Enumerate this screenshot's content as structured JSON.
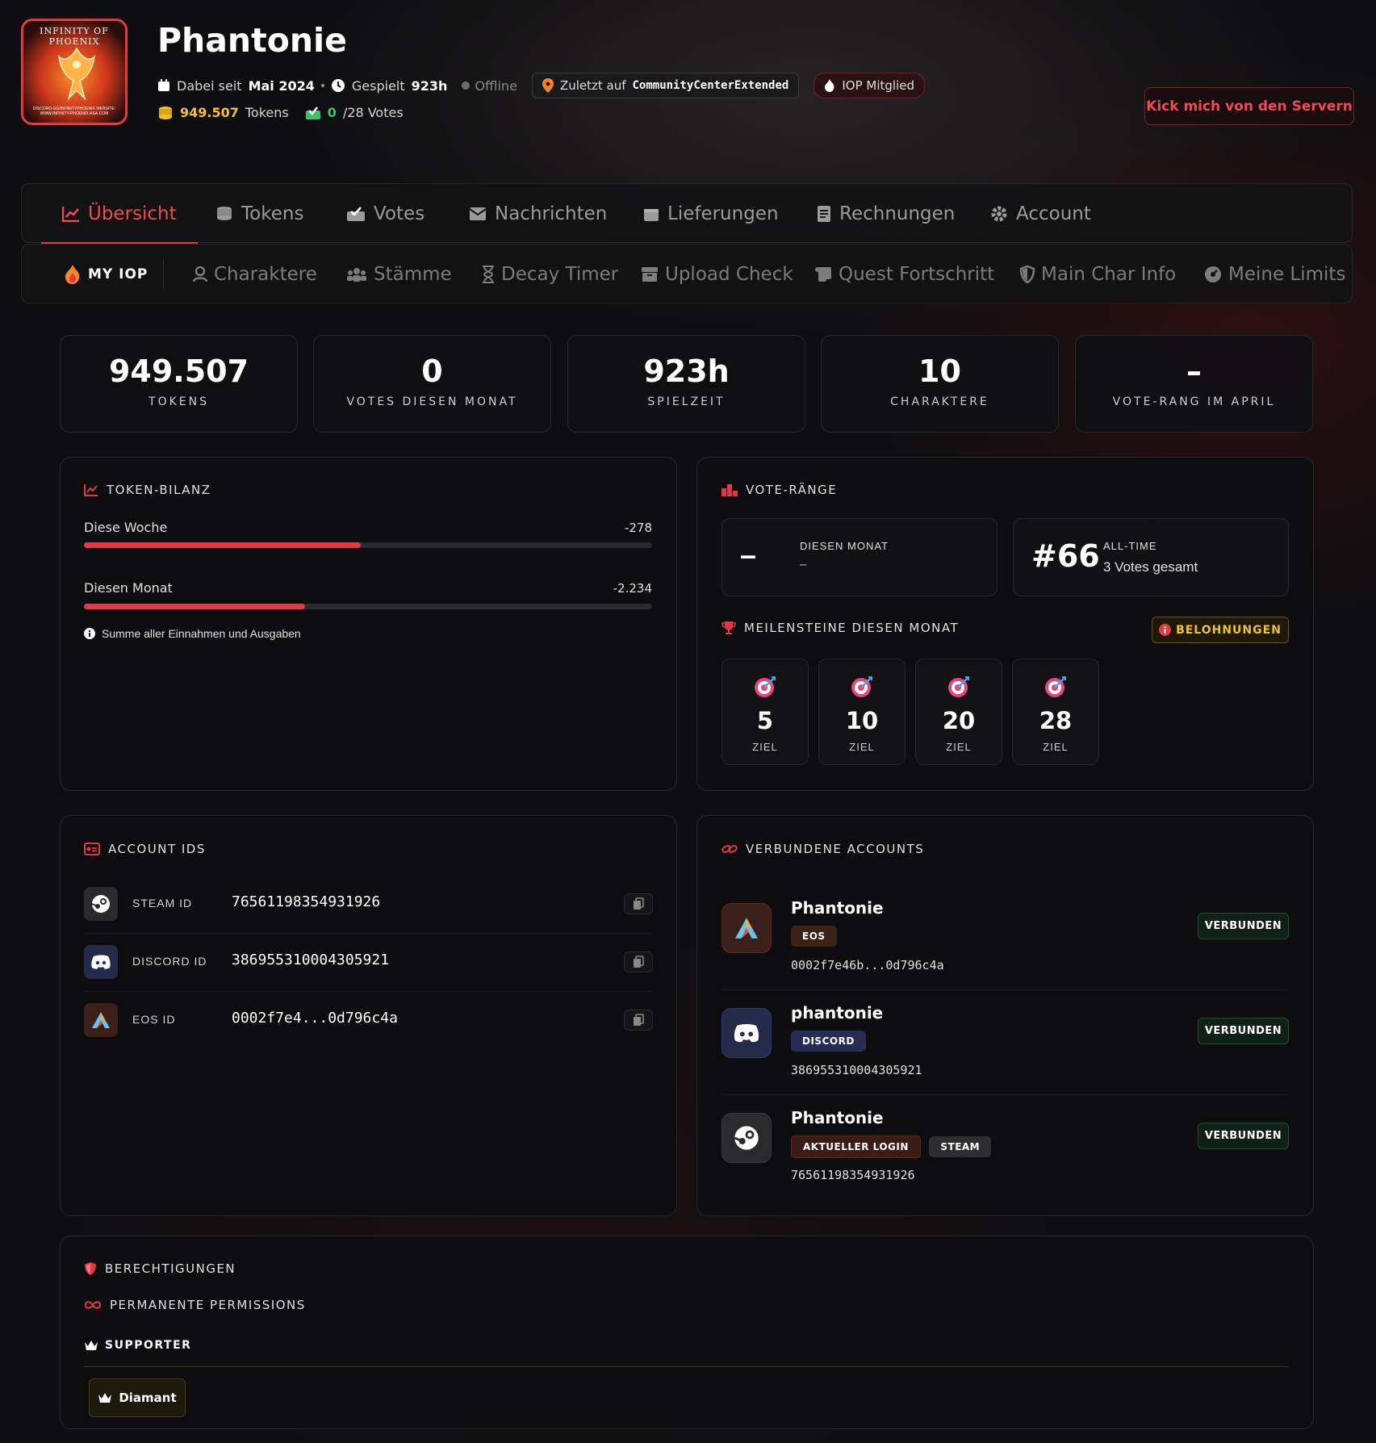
{
  "profile": {
    "logo_text_top": "INFINITY OF PHOENIX",
    "logo_text_bottom": "DISCORD.GG/INFINITYPHOENIX WEBSITE: WWW.INFINITY-PHOENIX-ASA.COM",
    "name": "Phantonie",
    "since_label": "Dabei seit",
    "since_value": "Mai 2024",
    "played_label": "Gespielt",
    "played_value": "923h",
    "status": "Offline",
    "last_on_label": "Zuletzt auf",
    "last_on_value": "CommunityCenterExtended",
    "member_badge": "IOP Mitglied",
    "tokens_value": "949.507",
    "tokens_label": "Tokens",
    "votes_value": "0",
    "votes_label": "/28 Votes",
    "kick_button": "Kick mich von den Servern"
  },
  "tabs": [
    {
      "label": "Übersicht",
      "icon": "chart-line-icon"
    },
    {
      "label": "Tokens",
      "icon": "coins-icon"
    },
    {
      "label": "Votes",
      "icon": "vote-box-icon"
    },
    {
      "label": "Nachrichten",
      "icon": "envelope-icon"
    },
    {
      "label": "Lieferungen",
      "icon": "gift-icon"
    },
    {
      "label": "Rechnungen",
      "icon": "invoice-icon"
    },
    {
      "label": "Account",
      "icon": "gear-icon"
    }
  ],
  "subtabs": [
    {
      "label": "MY IOP",
      "icon": "flame-icon"
    },
    {
      "label": "Charaktere",
      "icon": "user-icon"
    },
    {
      "label": "Stämme",
      "icon": "group-icon"
    },
    {
      "label": "Decay Timer",
      "icon": "hourglass-icon"
    },
    {
      "label": "Upload Check",
      "icon": "archive-icon"
    },
    {
      "label": "Quest Fortschritt",
      "icon": "scroll-icon"
    },
    {
      "label": "Main Char Info",
      "icon": "shield-icon"
    },
    {
      "label": "Meine Limits",
      "icon": "gauge-icon"
    }
  ],
  "stats": [
    {
      "value": "949.507",
      "label": "TOKENS"
    },
    {
      "value": "0",
      "label": "VOTES DIESEN MONAT"
    },
    {
      "value": "923h",
      "label": "SPIELZEIT"
    },
    {
      "value": "10",
      "label": "CHARAKTERE"
    },
    {
      "value": "–",
      "label": "VOTE-RANG IM APRIL"
    }
  ],
  "token_balance": {
    "title": "TOKEN-BILANZ",
    "rows": [
      {
        "label": "Diese Woche",
        "value": "-278",
        "fill": 0.487
      },
      {
        "label": "Diesen Monat",
        "value": "-2.234",
        "fill": 0.389
      }
    ],
    "note": "Summe aller Einnahmen und Ausgaben"
  },
  "vote_ranks": {
    "title": "VOTE-RÄNGE",
    "month": {
      "rank": "–",
      "label": "DIESEN MONAT",
      "sub": "–"
    },
    "alltime": {
      "rank": "#66",
      "label": "ALL-TIME",
      "sub": "3 Votes gesamt"
    },
    "milestones_title": "MEILENSTEINE DIESEN MONAT",
    "rewards_button": "BELOHNUNGEN",
    "milestones": [
      {
        "value": "5",
        "label": "ZIEL"
      },
      {
        "value": "10",
        "label": "ZIEL"
      },
      {
        "value": "20",
        "label": "ZIEL"
      },
      {
        "value": "28",
        "label": "ZIEL"
      }
    ]
  },
  "account_ids": {
    "title": "ACCOUNT IDS",
    "rows": [
      {
        "label": "STEAM ID",
        "value": "76561198354931926",
        "icon": "steam-icon"
      },
      {
        "label": "DISCORD ID",
        "value": "386955310004305921",
        "icon": "discord-icon"
      },
      {
        "label": "EOS ID",
        "value": "0002f7e4...0d796c4a",
        "icon": "ark-icon"
      }
    ]
  },
  "linked_accounts": {
    "title": "VERBUNDENE ACCOUNTS",
    "items": [
      {
        "name": "Phantonie",
        "tags": [
          "EOS"
        ],
        "id": "0002f7e46b...0d796c4a",
        "status": "VERBUNDEN",
        "icon": "ark-icon"
      },
      {
        "name": "phantonie",
        "tags": [
          "DISCORD"
        ],
        "id": "386955310004305921",
        "status": "VERBUNDEN",
        "icon": "discord-icon"
      },
      {
        "name": "Phantonie",
        "tags": [
          "AKTUELLER LOGIN",
          "STEAM"
        ],
        "id": "76561198354931926",
        "status": "VERBUNDEN",
        "icon": "steam-icon"
      }
    ]
  },
  "permissions": {
    "title": "BERECHTIGUNGEN",
    "permanent_title": "PERMANENTE PERMISSIONS",
    "group_title": "SUPPORTER",
    "badge": "Diamant"
  },
  "colors": {
    "accent": "#e23a45",
    "gold": "#f2c12e",
    "green": "#3fc167"
  }
}
